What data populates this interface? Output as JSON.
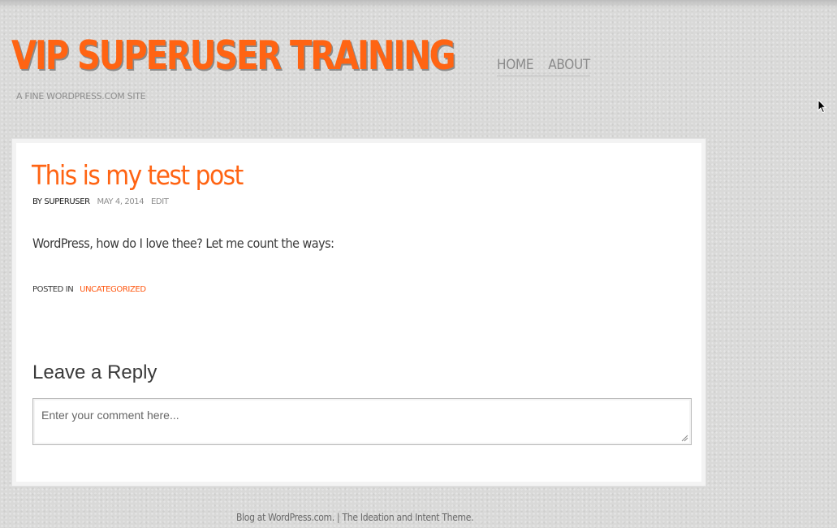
{
  "header": {
    "site_title": "VIP SUPERUSER TRAINING",
    "tagline": "A FINE WORDPRESS.COM SITE",
    "nav": [
      {
        "label": "HOME"
      },
      {
        "label": "ABOUT"
      }
    ]
  },
  "post": {
    "title": "This is my test post",
    "meta": {
      "author": "BY SUPERUSER",
      "date": "MAY 4, 2014",
      "edit": "EDIT"
    },
    "body": "WordPress, how do I love thee? Let me count the ways:",
    "posted_in_label": "POSTED IN",
    "category": "UNCATEGORIZED"
  },
  "reply": {
    "heading": "Leave a Reply",
    "placeholder": "Enter your comment here..."
  },
  "footer": {
    "blog_link": "Blog at WordPress.com.",
    "separator": " | ",
    "theme_link": "The Ideation and Intent Theme."
  },
  "colors": {
    "accent": "#ff6413",
    "background": "#d9d9d8",
    "text": "#3a3a3a",
    "muted": "#8d8d8d"
  },
  "icons": {
    "cursor": "mouse-pointer-icon",
    "grip": "resize-grip-icon"
  }
}
